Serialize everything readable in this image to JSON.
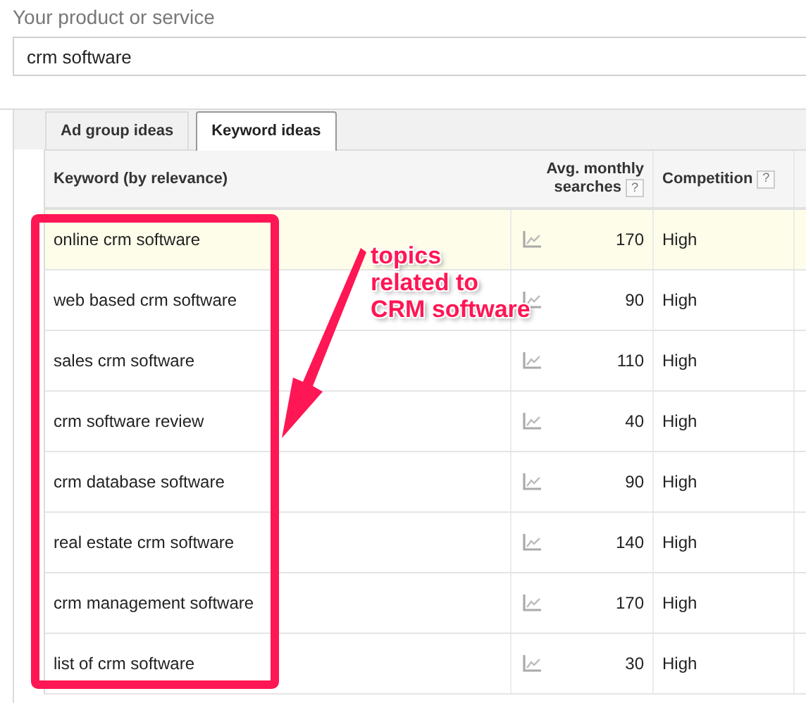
{
  "field": {
    "label": "Your product or service",
    "value": "crm software"
  },
  "tabs": [
    {
      "label": "Ad group ideas",
      "selected": false
    },
    {
      "label": "Keyword ideas",
      "selected": true
    }
  ],
  "table": {
    "columns": [
      {
        "label": "Keyword (by relevance)"
      },
      {
        "label": "Avg. monthly searches",
        "help": "?"
      },
      {
        "label": "Competition",
        "help": "?"
      }
    ],
    "rows": [
      {
        "keyword": "online crm software",
        "searches": "170",
        "competition": "High",
        "highlighted": true
      },
      {
        "keyword": "web based crm software",
        "searches": "90",
        "competition": "High",
        "highlighted": false
      },
      {
        "keyword": "sales crm software",
        "searches": "110",
        "competition": "High",
        "highlighted": false
      },
      {
        "keyword": "crm software review",
        "searches": "40",
        "competition": "High",
        "highlighted": false
      },
      {
        "keyword": "crm database software",
        "searches": "90",
        "competition": "High",
        "highlighted": false
      },
      {
        "keyword": "real estate crm software",
        "searches": "140",
        "competition": "High",
        "highlighted": false
      },
      {
        "keyword": "crm management software",
        "searches": "170",
        "competition": "High",
        "highlighted": false
      },
      {
        "keyword": "list of crm software",
        "searches": "30",
        "competition": "High",
        "highlighted": false
      }
    ]
  },
  "annotation": {
    "text": "topics\nrelated to\nCRM software"
  }
}
